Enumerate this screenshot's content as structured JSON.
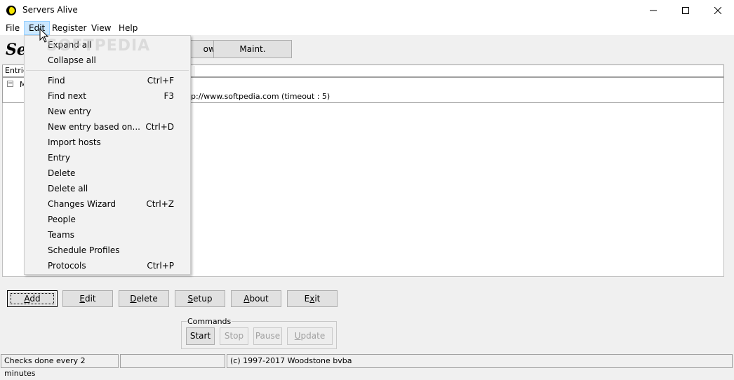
{
  "window": {
    "title": "Servers Alive",
    "controls": {
      "minimize_icon": "minimize-icon",
      "maximize_icon": "maximize-icon",
      "close_icon": "close-icon"
    }
  },
  "menubar": {
    "items": [
      {
        "label": "File"
      },
      {
        "label": "Edit",
        "active": true
      },
      {
        "label": "Register"
      },
      {
        "label": "View"
      },
      {
        "label": "Help"
      }
    ]
  },
  "header": {
    "app_name_partial": "Se",
    "buttons": [
      {
        "label": "own"
      },
      {
        "label": "Maint."
      }
    ]
  },
  "list": {
    "column_header": "Entrie",
    "tree_item_label": "M",
    "tree_item_detail": "p://www.softpedia.com  (timeout :  5)"
  },
  "edit_menu": {
    "items": [
      {
        "label": "Expand all",
        "shortcut": ""
      },
      {
        "label": "Collapse all",
        "shortcut": ""
      },
      {
        "label": "Find",
        "shortcut": "Ctrl+F"
      },
      {
        "label": "Find next",
        "shortcut": "F3"
      },
      {
        "label": "New entry",
        "shortcut": ""
      },
      {
        "label": "New entry based on...",
        "shortcut": "Ctrl+D"
      },
      {
        "label": "Import hosts",
        "shortcut": ""
      },
      {
        "label": "Entry",
        "shortcut": ""
      },
      {
        "label": "Delete",
        "shortcut": ""
      },
      {
        "label": "Delete all",
        "shortcut": ""
      },
      {
        "label": "Changes Wizard",
        "shortcut": "Ctrl+Z"
      },
      {
        "label": "People",
        "shortcut": ""
      },
      {
        "label": "Teams",
        "shortcut": ""
      },
      {
        "label": "Schedule Profiles",
        "shortcut": ""
      },
      {
        "label": "Protocols",
        "shortcut": "Ctrl+P"
      }
    ]
  },
  "buttons": {
    "add": {
      "mnemonic": "A",
      "rest": "dd"
    },
    "edit": {
      "mnemonic": "E",
      "rest": "dit"
    },
    "delete": {
      "mnemonic": "D",
      "rest": "elete"
    },
    "setup": {
      "mnemonic": "S",
      "rest": "etup"
    },
    "about": {
      "mnemonic": "A",
      "rest": "bout"
    },
    "exit": {
      "pre": "E",
      "mnemonic": "x",
      "rest": "it"
    }
  },
  "commands": {
    "legend": "Commands",
    "start": "Start",
    "stop": "Stop",
    "pause": "Pause",
    "update_mnemonic": "U",
    "update_rest": "pdate"
  },
  "statusbar": {
    "checks": "Checks done every  2 minutes",
    "middle": "",
    "copyright": "(c) 1997-2017 Woodstone bvba"
  },
  "watermark": "SOFTPEDIA",
  "colors": {
    "menu_highlight": "#cce8ff",
    "menu_highlight_border": "#99d1ff"
  }
}
